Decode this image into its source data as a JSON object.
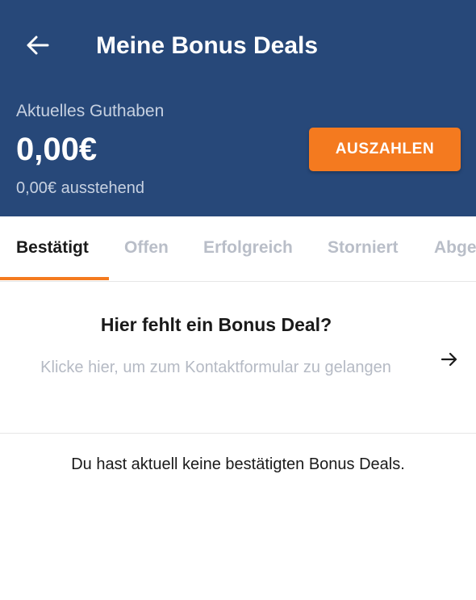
{
  "header": {
    "title": "Meine Bonus Deals",
    "back_icon": "arrow-left-icon",
    "background_color": "#274879"
  },
  "balance": {
    "label": "Aktuelles Guthaben",
    "value": "0,00€",
    "pending": "0,00€ ausstehend"
  },
  "payout_button": {
    "label": "AUSZAHLEN",
    "color": "#f47a1f"
  },
  "tabs": [
    {
      "label": "Bestätigt",
      "active": true
    },
    {
      "label": "Offen",
      "active": false
    },
    {
      "label": "Erfolgreich",
      "active": false
    },
    {
      "label": "Storniert",
      "active": false
    },
    {
      "label": "Abge",
      "active": false
    }
  ],
  "missing_deal": {
    "title": "Hier fehlt ein Bonus Deal?",
    "text": "Klicke hier, um zum Kontaktformular zu gelangen",
    "arrow_icon": "arrow-right-icon"
  },
  "empty_state": {
    "text": "Du hast aktuell keine bestätigten Bonus Deals."
  }
}
